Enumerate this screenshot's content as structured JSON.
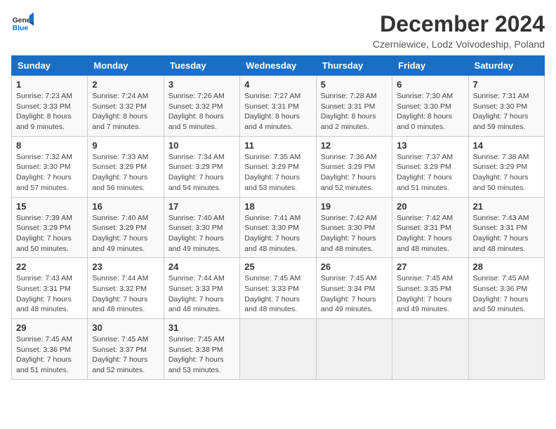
{
  "header": {
    "logo_line1": "General",
    "logo_line2": "Blue",
    "title": "December 2024",
    "subtitle": "Czerniewice, Lodz Voivodeship, Poland"
  },
  "weekdays": [
    "Sunday",
    "Monday",
    "Tuesday",
    "Wednesday",
    "Thursday",
    "Friday",
    "Saturday"
  ],
  "weeks": [
    [
      {
        "day": "1",
        "sunrise": "Sunrise: 7:23 AM",
        "sunset": "Sunset: 3:33 PM",
        "daylight": "Daylight: 8 hours and 9 minutes."
      },
      {
        "day": "2",
        "sunrise": "Sunrise: 7:24 AM",
        "sunset": "Sunset: 3:32 PM",
        "daylight": "Daylight: 8 hours and 7 minutes."
      },
      {
        "day": "3",
        "sunrise": "Sunrise: 7:26 AM",
        "sunset": "Sunset: 3:32 PM",
        "daylight": "Daylight: 8 hours and 5 minutes."
      },
      {
        "day": "4",
        "sunrise": "Sunrise: 7:27 AM",
        "sunset": "Sunset: 3:31 PM",
        "daylight": "Daylight: 8 hours and 4 minutes."
      },
      {
        "day": "5",
        "sunrise": "Sunrise: 7:28 AM",
        "sunset": "Sunset: 3:31 PM",
        "daylight": "Daylight: 8 hours and 2 minutes."
      },
      {
        "day": "6",
        "sunrise": "Sunrise: 7:30 AM",
        "sunset": "Sunset: 3:30 PM",
        "daylight": "Daylight: 8 hours and 0 minutes."
      },
      {
        "day": "7",
        "sunrise": "Sunrise: 7:31 AM",
        "sunset": "Sunset: 3:30 PM",
        "daylight": "Daylight: 7 hours and 59 minutes."
      }
    ],
    [
      {
        "day": "8",
        "sunrise": "Sunrise: 7:32 AM",
        "sunset": "Sunset: 3:30 PM",
        "daylight": "Daylight: 7 hours and 57 minutes."
      },
      {
        "day": "9",
        "sunrise": "Sunrise: 7:33 AM",
        "sunset": "Sunset: 3:29 PM",
        "daylight": "Daylight: 7 hours and 56 minutes."
      },
      {
        "day": "10",
        "sunrise": "Sunrise: 7:34 AM",
        "sunset": "Sunset: 3:29 PM",
        "daylight": "Daylight: 7 hours and 54 minutes."
      },
      {
        "day": "11",
        "sunrise": "Sunrise: 7:35 AM",
        "sunset": "Sunset: 3:29 PM",
        "daylight": "Daylight: 7 hours and 53 minutes."
      },
      {
        "day": "12",
        "sunrise": "Sunrise: 7:36 AM",
        "sunset": "Sunset: 3:29 PM",
        "daylight": "Daylight: 7 hours and 52 minutes."
      },
      {
        "day": "13",
        "sunrise": "Sunrise: 7:37 AM",
        "sunset": "Sunset: 3:29 PM",
        "daylight": "Daylight: 7 hours and 51 minutes."
      },
      {
        "day": "14",
        "sunrise": "Sunrise: 7:38 AM",
        "sunset": "Sunset: 3:29 PM",
        "daylight": "Daylight: 7 hours and 50 minutes."
      }
    ],
    [
      {
        "day": "15",
        "sunrise": "Sunrise: 7:39 AM",
        "sunset": "Sunset: 3:29 PM",
        "daylight": "Daylight: 7 hours and 50 minutes."
      },
      {
        "day": "16",
        "sunrise": "Sunrise: 7:40 AM",
        "sunset": "Sunset: 3:29 PM",
        "daylight": "Daylight: 7 hours and 49 minutes."
      },
      {
        "day": "17",
        "sunrise": "Sunrise: 7:40 AM",
        "sunset": "Sunset: 3:30 PM",
        "daylight": "Daylight: 7 hours and 49 minutes."
      },
      {
        "day": "18",
        "sunrise": "Sunrise: 7:41 AM",
        "sunset": "Sunset: 3:30 PM",
        "daylight": "Daylight: 7 hours and 48 minutes."
      },
      {
        "day": "19",
        "sunrise": "Sunrise: 7:42 AM",
        "sunset": "Sunset: 3:30 PM",
        "daylight": "Daylight: 7 hours and 48 minutes."
      },
      {
        "day": "20",
        "sunrise": "Sunrise: 7:42 AM",
        "sunset": "Sunset: 3:31 PM",
        "daylight": "Daylight: 7 hours and 48 minutes."
      },
      {
        "day": "21",
        "sunrise": "Sunrise: 7:43 AM",
        "sunset": "Sunset: 3:31 PM",
        "daylight": "Daylight: 7 hours and 48 minutes."
      }
    ],
    [
      {
        "day": "22",
        "sunrise": "Sunrise: 7:43 AM",
        "sunset": "Sunset: 3:31 PM",
        "daylight": "Daylight: 7 hours and 48 minutes."
      },
      {
        "day": "23",
        "sunrise": "Sunrise: 7:44 AM",
        "sunset": "Sunset: 3:32 PM",
        "daylight": "Daylight: 7 hours and 48 minutes."
      },
      {
        "day": "24",
        "sunrise": "Sunrise: 7:44 AM",
        "sunset": "Sunset: 3:33 PM",
        "daylight": "Daylight: 7 hours and 48 minutes."
      },
      {
        "day": "25",
        "sunrise": "Sunrise: 7:45 AM",
        "sunset": "Sunset: 3:33 PM",
        "daylight": "Daylight: 7 hours and 48 minutes."
      },
      {
        "day": "26",
        "sunrise": "Sunrise: 7:45 AM",
        "sunset": "Sunset: 3:34 PM",
        "daylight": "Daylight: 7 hours and 49 minutes."
      },
      {
        "day": "27",
        "sunrise": "Sunrise: 7:45 AM",
        "sunset": "Sunset: 3:35 PM",
        "daylight": "Daylight: 7 hours and 49 minutes."
      },
      {
        "day": "28",
        "sunrise": "Sunrise: 7:45 AM",
        "sunset": "Sunset: 3:36 PM",
        "daylight": "Daylight: 7 hours and 50 minutes."
      }
    ],
    [
      {
        "day": "29",
        "sunrise": "Sunrise: 7:45 AM",
        "sunset": "Sunset: 3:36 PM",
        "daylight": "Daylight: 7 hours and 51 minutes."
      },
      {
        "day": "30",
        "sunrise": "Sunrise: 7:45 AM",
        "sunset": "Sunset: 3:37 PM",
        "daylight": "Daylight: 7 hours and 52 minutes."
      },
      {
        "day": "31",
        "sunrise": "Sunrise: 7:45 AM",
        "sunset": "Sunset: 3:38 PM",
        "daylight": "Daylight: 7 hours and 53 minutes."
      },
      null,
      null,
      null,
      null
    ]
  ]
}
